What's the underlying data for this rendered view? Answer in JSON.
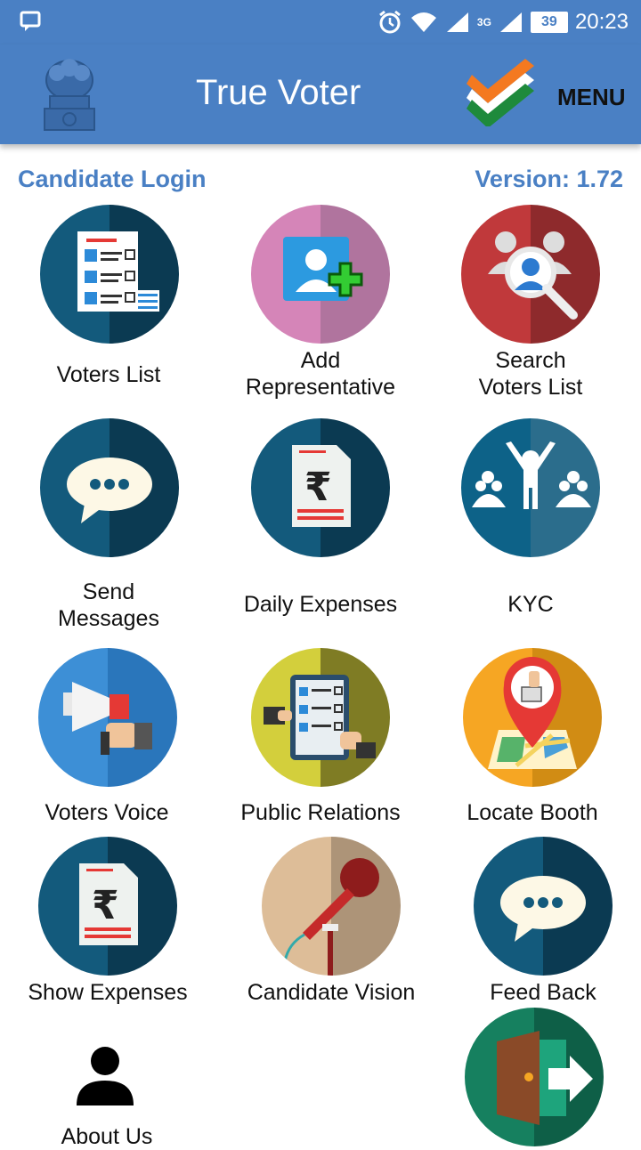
{
  "status_bar": {
    "time": "20:23",
    "battery": "39",
    "network_label": "3G"
  },
  "app_bar": {
    "title": "True Voter",
    "menu": "MENU"
  },
  "header": {
    "login": "Candidate Login",
    "version": "Version: 1.72"
  },
  "tiles": [
    {
      "label": "Voters List"
    },
    {
      "label": "Add\nRepresentative"
    },
    {
      "label": "Search\nVoters List"
    },
    {
      "label": "Send\nMessages"
    },
    {
      "label": "Daily Expenses"
    },
    {
      "label": "KYC"
    },
    {
      "label": "Voters Voice"
    },
    {
      "label": "Public Relations"
    },
    {
      "label": "Locate Booth"
    },
    {
      "label": "Show Expenses"
    },
    {
      "label": "Candidate Vision"
    },
    {
      "label": "Feed Back"
    },
    {
      "label": "About Us"
    }
  ],
  "colors": {
    "primary": "#4a80c4",
    "dark_teal": "#0d4a66"
  }
}
